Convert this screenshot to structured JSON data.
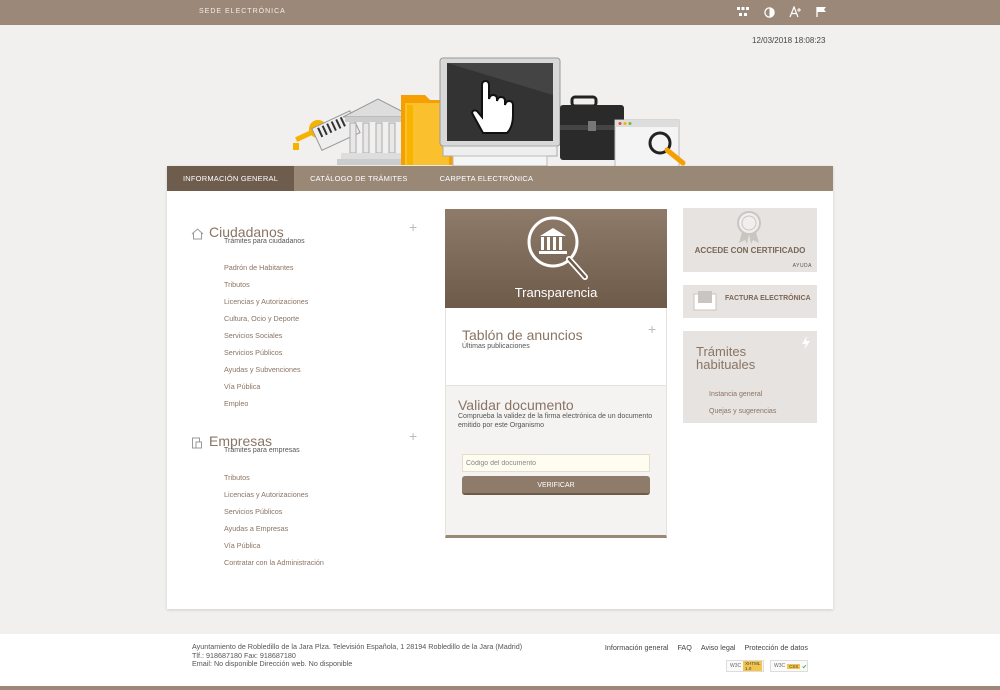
{
  "topbar": {
    "site_name": "SEDE ELECTRÓNICA",
    "tools": [
      "sitemap-icon",
      "contrast-icon",
      "font-size-icon",
      "language-flag-icon"
    ]
  },
  "datetime": "12/03/2018 18:08:23",
  "nav": {
    "tabs": [
      {
        "label": "INFORMACIÓN GENERAL",
        "active": true
      },
      {
        "label": "CATÁLOGO DE TRÁMITES",
        "active": false
      },
      {
        "label": "CARPETA ELECTRÓNICA",
        "active": false
      }
    ]
  },
  "ciudadanos": {
    "title": "Ciudadanos",
    "subtitle": "Trámites para ciudadanos",
    "items": [
      "Padrón de Habitantes",
      "Tributos",
      "Licencias y Autorizaciones",
      "Cultura, Ocio y Deporte",
      "Servicios Sociales",
      "Servicios Públicos",
      "Ayudas y Subvenciones",
      "Vía Pública",
      "Empleo"
    ]
  },
  "empresas": {
    "title": "Empresas",
    "subtitle": "Trámites para empresas",
    "items": [
      "Tributos",
      "Licencias y Autorizaciones",
      "Servicios Públicos",
      "Ayudas a Empresas",
      "Vía Pública",
      "Contratar con la Administración"
    ]
  },
  "transparencia": {
    "label": "Transparencia"
  },
  "tablon": {
    "title": "Tablón de anuncios",
    "subtitle": "Últimas publicaciones"
  },
  "validar": {
    "title": "Validar documento",
    "description": "Comprueba la validez de la firma electrónica de un documento emitido por este Organismo",
    "input_placeholder": "Código del documento",
    "button_label": "VERIFICAR"
  },
  "certificado": {
    "label": "ACCEDE CON CERTIFICADO",
    "help": "AYUDA"
  },
  "factura": {
    "label": "FACTURA ELECTRÓNICA"
  },
  "habituales": {
    "title": "Trámites habituales",
    "items": [
      "Instancia general",
      "Quejas y sugerencias"
    ]
  },
  "footer": {
    "address_line1": "Ayuntamiento de Robledillo de la Jara Plza. Televisión Española, 1 28194 Robledillo de la Jara (Madrid)",
    "address_line2": "Tlf.: 918687180 Fax: 918687180",
    "address_line3": "Email: No disponible Dirección web. No disponible",
    "links": [
      "Información general",
      "FAQ",
      "Aviso legal",
      "Protección de datos"
    ],
    "badges": [
      {
        "org": "W3C",
        "tag": "XHTML 1.0"
      },
      {
        "org": "W3C",
        "tag": "CSS"
      }
    ]
  }
}
